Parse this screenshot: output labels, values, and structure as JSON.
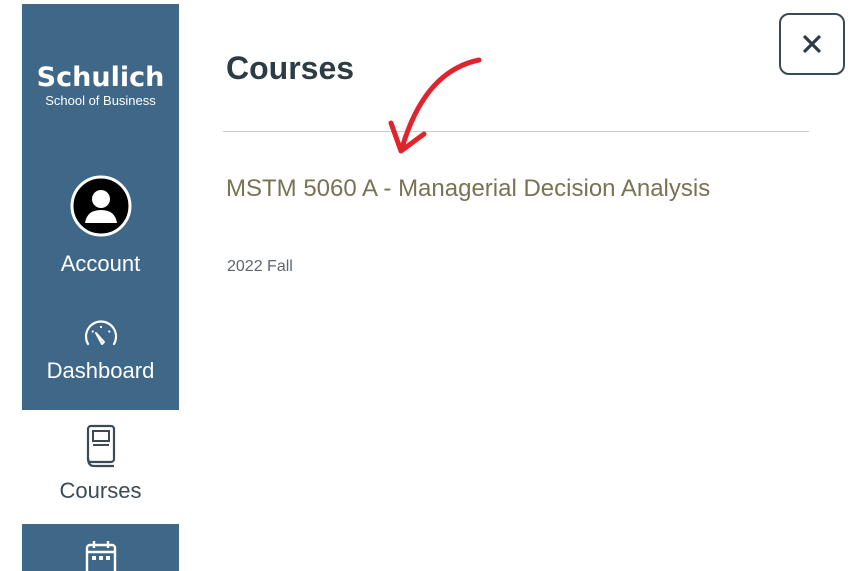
{
  "brand": {
    "name": "Schulich",
    "subtitle": "School of Business"
  },
  "global_nav": {
    "items": [
      {
        "label": "Account",
        "icon": "avatar-icon"
      },
      {
        "label": "Dashboard",
        "icon": "dashboard-gauge-icon"
      },
      {
        "label": "Courses",
        "icon": "courses-book-icon",
        "active": true
      },
      {
        "label": "",
        "icon": "calendar-icon"
      }
    ]
  },
  "tray": {
    "title": "Courses",
    "close_icon": "close-icon",
    "courses": [
      {
        "name": "MSTM 5060 A - Managerial Decision Analysis",
        "term": "2022 Fall"
      }
    ]
  },
  "colors": {
    "nav_background": "#3f6788",
    "title_text": "#2d3b45",
    "course_link": "#787354",
    "annotation_arrow": "#e0242b"
  }
}
